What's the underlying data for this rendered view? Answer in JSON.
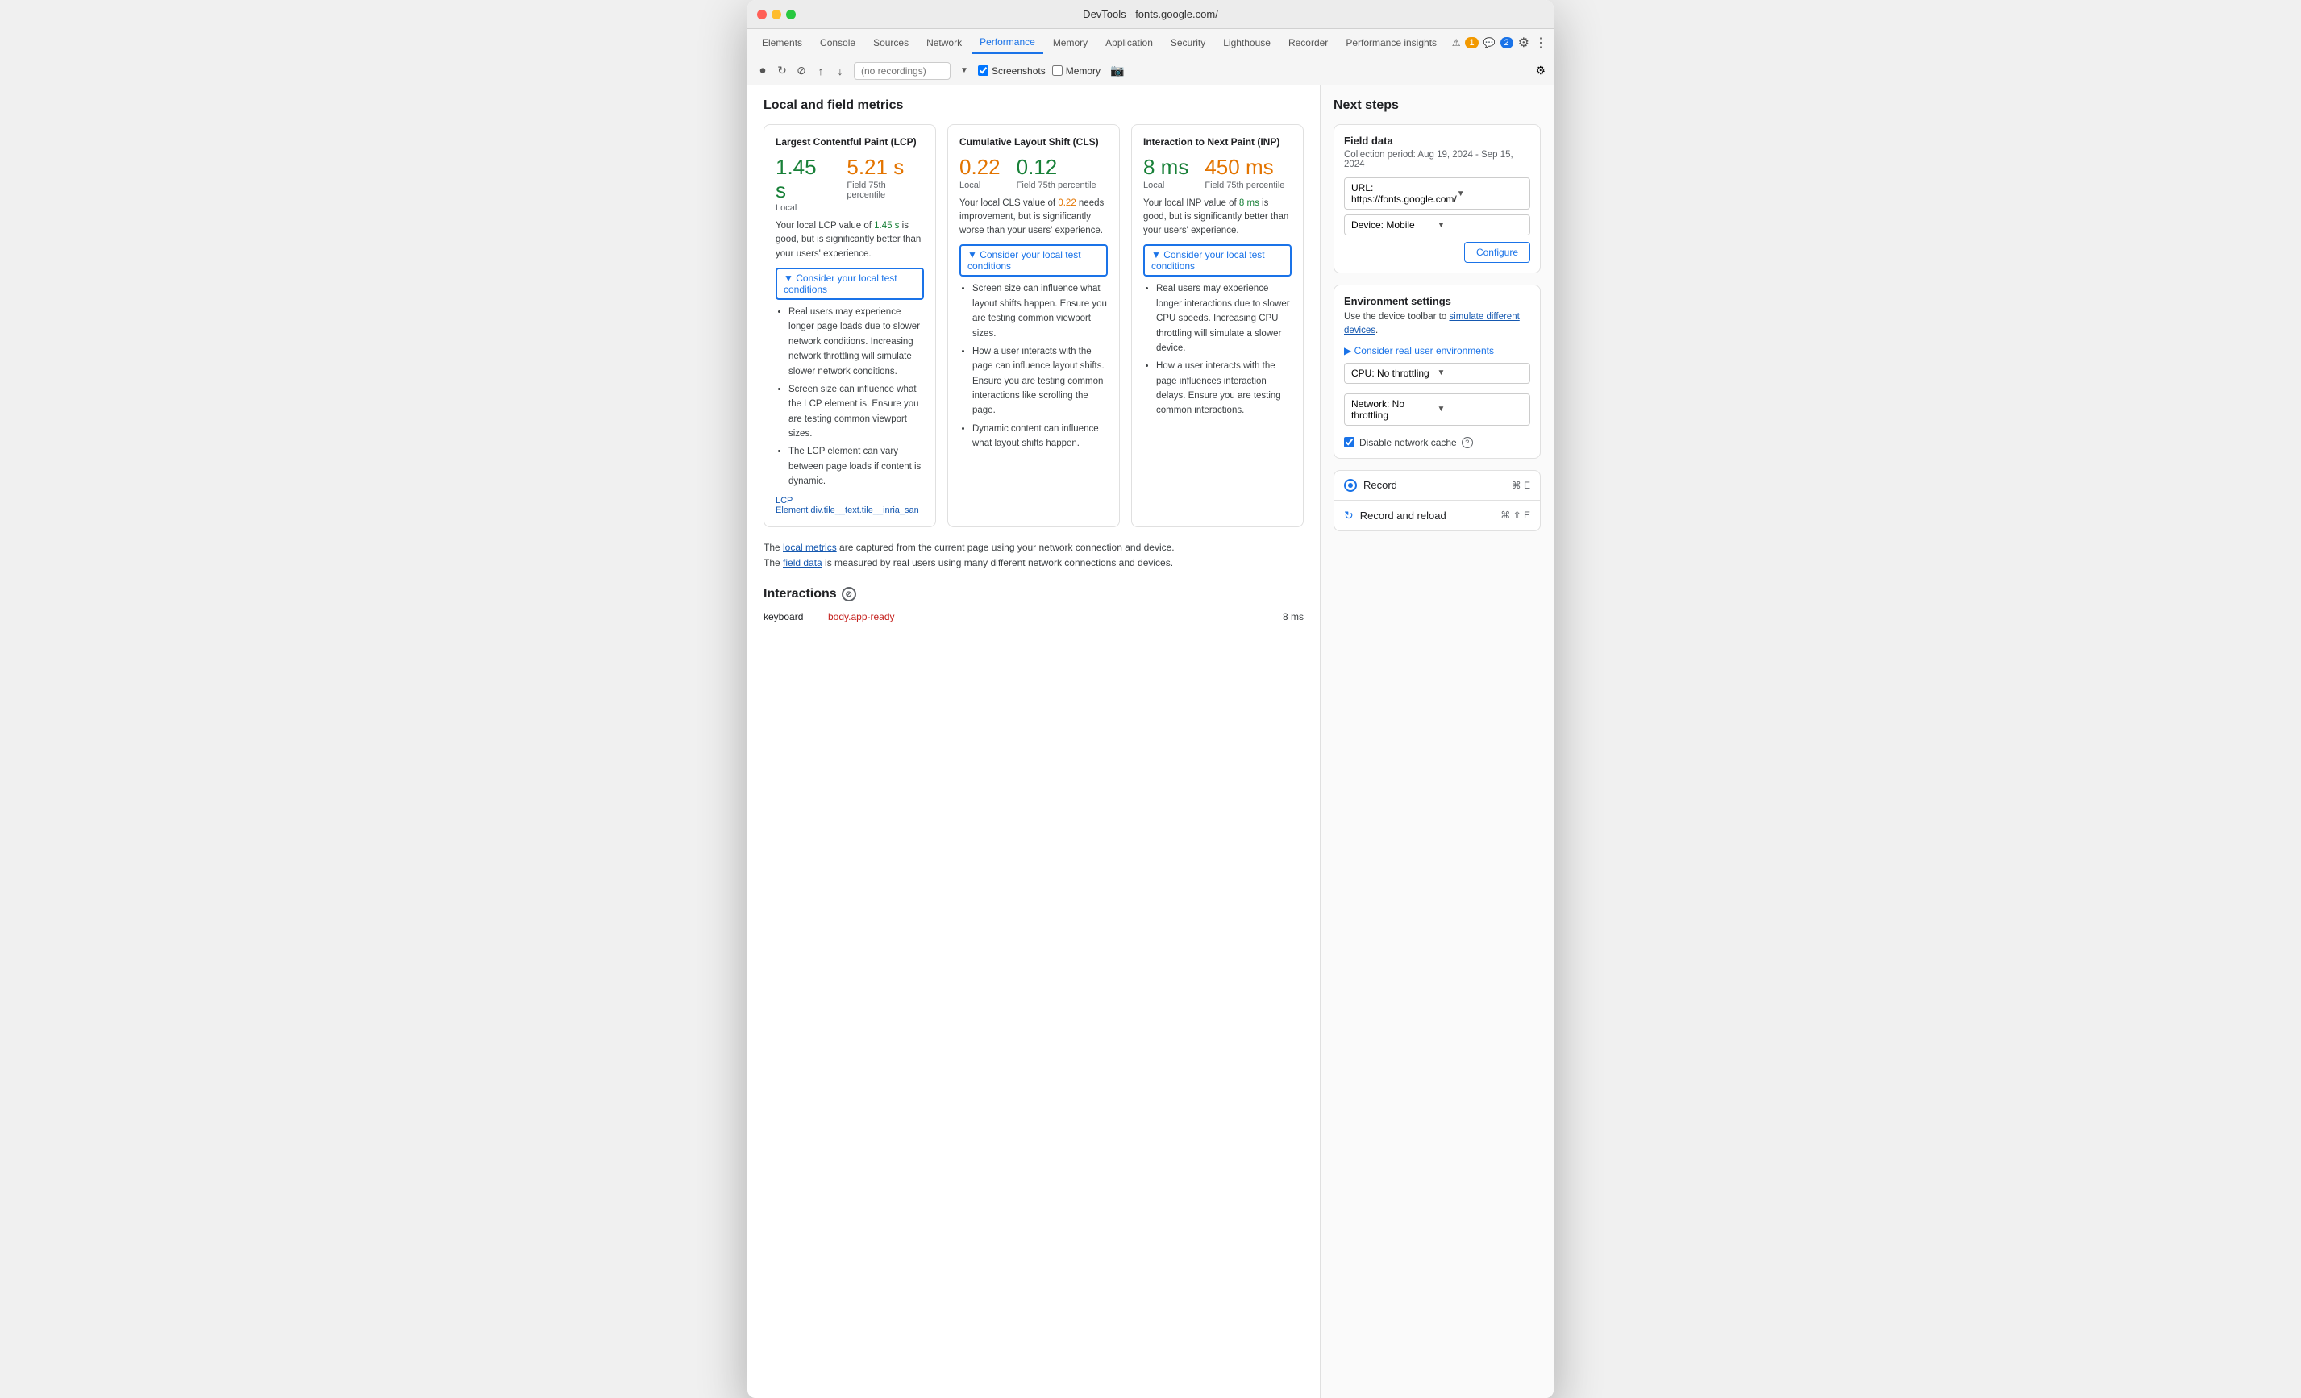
{
  "window": {
    "title": "DevTools - fonts.google.com/"
  },
  "tabs": [
    {
      "id": "elements",
      "label": "Elements",
      "active": false
    },
    {
      "id": "console",
      "label": "Console",
      "active": false
    },
    {
      "id": "sources",
      "label": "Sources",
      "active": false
    },
    {
      "id": "network",
      "label": "Network",
      "active": false
    },
    {
      "id": "performance",
      "label": "Performance",
      "active": true
    },
    {
      "id": "memory",
      "label": "Memory",
      "active": false
    },
    {
      "id": "application",
      "label": "Application",
      "active": false
    },
    {
      "id": "security",
      "label": "Security",
      "active": false
    },
    {
      "id": "lighthouse",
      "label": "Lighthouse",
      "active": false
    },
    {
      "id": "recorder",
      "label": "Recorder",
      "active": false
    },
    {
      "id": "perf-insights",
      "label": "Performance insights",
      "active": false
    }
  ],
  "tab_bar_right": {
    "warning_count": "1",
    "info_count": "2"
  },
  "toolbar": {
    "recordings_placeholder": "(no recordings)",
    "screenshots_label": "Screenshots",
    "memory_label": "Memory"
  },
  "left_panel": {
    "section_title": "Local and field metrics",
    "metrics": [
      {
        "id": "lcp",
        "title": "Largest Contentful Paint (LCP)",
        "local_value": "1.45 s",
        "local_color": "green",
        "field_value": "5.21 s",
        "field_color": "orange",
        "field_label": "Field 75th percentile",
        "local_label": "Local",
        "description": "Your local LCP value of 1.45 s is good, but is significantly better than your users' experience.",
        "highlight_local": "1.45 s",
        "highlight_color": "green",
        "consider_label": "▼ Consider your local test conditions",
        "bullets": [
          "Real users may experience longer page loads due to slower network conditions. Increasing network throttling will simulate slower network conditions.",
          "Screen size can influence what the LCP element is. Ensure you are testing common viewport sizes.",
          "The LCP element can vary between page loads if content is dynamic."
        ],
        "lcp_element_label": "LCP Element",
        "lcp_element_value": "div.tile__text.tile__inria_san"
      },
      {
        "id": "cls",
        "title": "Cumulative Layout Shift (CLS)",
        "local_value": "0.22",
        "local_color": "orange",
        "field_value": "0.12",
        "field_color": "green",
        "field_label": "Field 75th percentile",
        "local_label": "Local",
        "description": "Your local CLS value of 0.22 needs improvement, but is significantly worse than your users' experience.",
        "highlight_local": "0.22",
        "highlight_color": "orange",
        "consider_label": "▼ Consider your local test conditions",
        "bullets": [
          "Screen size can influence what layout shifts happen. Ensure you are testing common viewport sizes.",
          "How a user interacts with the page can influence layout shifts. Ensure you are testing common interactions like scrolling the page.",
          "Dynamic content can influence what layout shifts happen."
        ]
      },
      {
        "id": "inp",
        "title": "Interaction to Next Paint (INP)",
        "local_value": "8 ms",
        "local_color": "green",
        "field_value": "450 ms",
        "field_color": "orange",
        "field_label": "Field 75th percentile",
        "local_label": "Local",
        "description": "Your local INP value of 8 ms is good, but is significantly better than your users' experience.",
        "highlight_local": "8 ms",
        "highlight_color": "green",
        "consider_label": "▼ Consider your local test conditions",
        "bullets": [
          "Real users may experience longer interactions due to slower CPU speeds. Increasing CPU throttling will simulate a slower device.",
          "How a user interacts with the page influences interaction delays. Ensure you are testing common interactions."
        ]
      }
    ],
    "footer_note_1": "The local metrics are captured from the current page using your network connection and device.",
    "footer_note_2": "The field data is measured by real users using many different network connections and devices.",
    "local_metrics_link": "local metrics",
    "field_data_link": "field data",
    "interactions_title": "Interactions",
    "interactions": [
      {
        "name": "keyboard",
        "link": "body.app-ready",
        "time": "8 ms"
      }
    ]
  },
  "right_panel": {
    "next_steps_title": "Next steps",
    "field_data": {
      "title": "Field data",
      "collection_period": "Collection period: Aug 19, 2024 - Sep 15, 2024",
      "url_label": "URL: https://fonts.google.com/",
      "device_label": "Device: Mobile",
      "configure_label": "Configure"
    },
    "environment": {
      "title": "Environment settings",
      "description_1": "Use the device toolbar to",
      "description_link": "simulate different devices",
      "description_2": ".",
      "consider_label": "▶ Consider real user environments",
      "cpu_label": "CPU: No throttling",
      "network_label": "Network: No throttling",
      "disable_cache_label": "Disable network cache"
    },
    "record": {
      "label": "Record",
      "shortcut": "⌘ E"
    },
    "record_reload": {
      "label": "Record and reload",
      "shortcut": "⌘ ⇧ E"
    }
  }
}
